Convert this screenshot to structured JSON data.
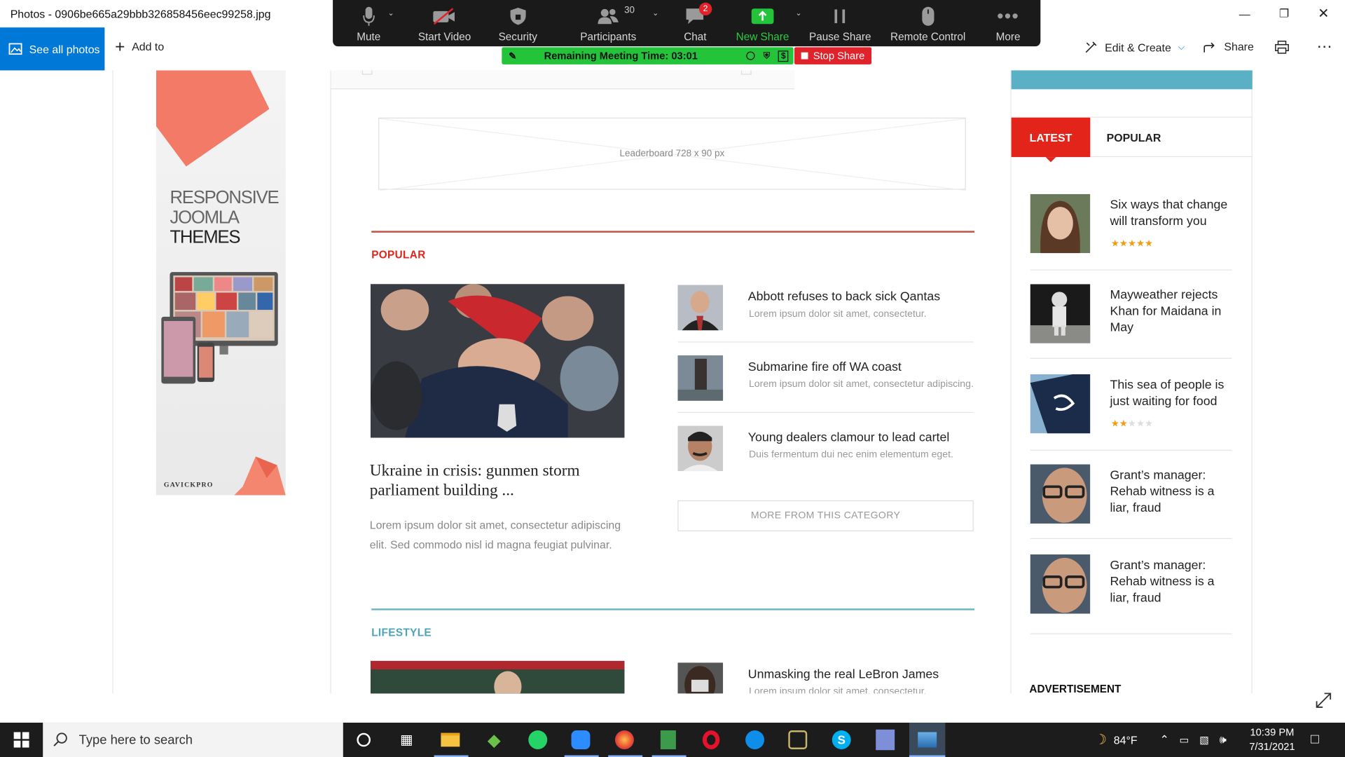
{
  "window": {
    "title": "Photos - 0906be665a29bbb326858456eec99258.jpg"
  },
  "photos_toolbar": {
    "see_all": "See all photos",
    "add_to": "Add to",
    "edit_create": "Edit & Create",
    "share": "Share"
  },
  "zoom": {
    "mute": "Mute",
    "start_video": "Start Video",
    "security": "Security",
    "participants": "Participants",
    "participants_count": "30",
    "chat": "Chat",
    "chat_badge": "2",
    "new_share": "New Share",
    "pause_share": "Pause Share",
    "remote_control": "Remote Control",
    "more": "More",
    "meeting_time": "Remaining Meeting Time: 03:01",
    "stop_share": "Stop Share"
  },
  "ad": {
    "line1": "RESPONSIVE",
    "line2": "JOOMLA",
    "line3": "THEMES",
    "brand": "GAVICKPRO"
  },
  "leaderboard": "Leaderboard  728 x 90 px",
  "popular": {
    "heading": "POPULAR",
    "main_title": "Ukraine in crisis: gunmen storm parliament building ...",
    "main_desc": "Lorem ipsum dolor sit amet, consectetur adipiscing elit. Sed commodo nisl id magna feugiat pulvinar.",
    "items": [
      {
        "title": "Abbott refuses to back sick Qantas",
        "desc": "Lorem ipsum dolor sit amet, consectetur."
      },
      {
        "title": "Submarine fire off WA coast",
        "desc": "Lorem ipsum dolor sit amet, consectetur adipiscing."
      },
      {
        "title": "Young dealers clamour to lead cartel",
        "desc": "Duis fermentum dui nec enim elementum eget."
      }
    ],
    "more": "MORE FROM THIS CATEGORY"
  },
  "lifestyle": {
    "heading": "LIFESTYLE",
    "item_title": "Unmasking the real LeBron James",
    "item_desc": "Lorem ipsum dolor sit amet, consectetur."
  },
  "sidebar": {
    "tab_latest": "LATEST",
    "tab_popular": "POPULAR",
    "items": [
      {
        "title": "Six ways that change will transform you",
        "rating": 5
      },
      {
        "title": "Mayweather rejects Khan for Maidana in May"
      },
      {
        "title": "This sea of people is just waiting for food",
        "rating": 2
      },
      {
        "title": "Grant’s manager: Rehab witness is a liar, fraud"
      },
      {
        "title": "Grant’s manager: Rehab witness is a liar, fraud"
      }
    ],
    "advertisement": "ADVERTISEMENT"
  },
  "taskbar": {
    "search_placeholder": "Type here to search",
    "temperature": "84°F",
    "time": "10:39 PM",
    "date": "7/31/2021"
  },
  "colors": {
    "accent_blue": "#0078d7",
    "zoom_green": "#23c43a",
    "stop_red": "#e0222b",
    "popular_red": "#e2241b",
    "lifestyle_teal": "#4ba4b8",
    "star_orange": "#f39c12"
  }
}
